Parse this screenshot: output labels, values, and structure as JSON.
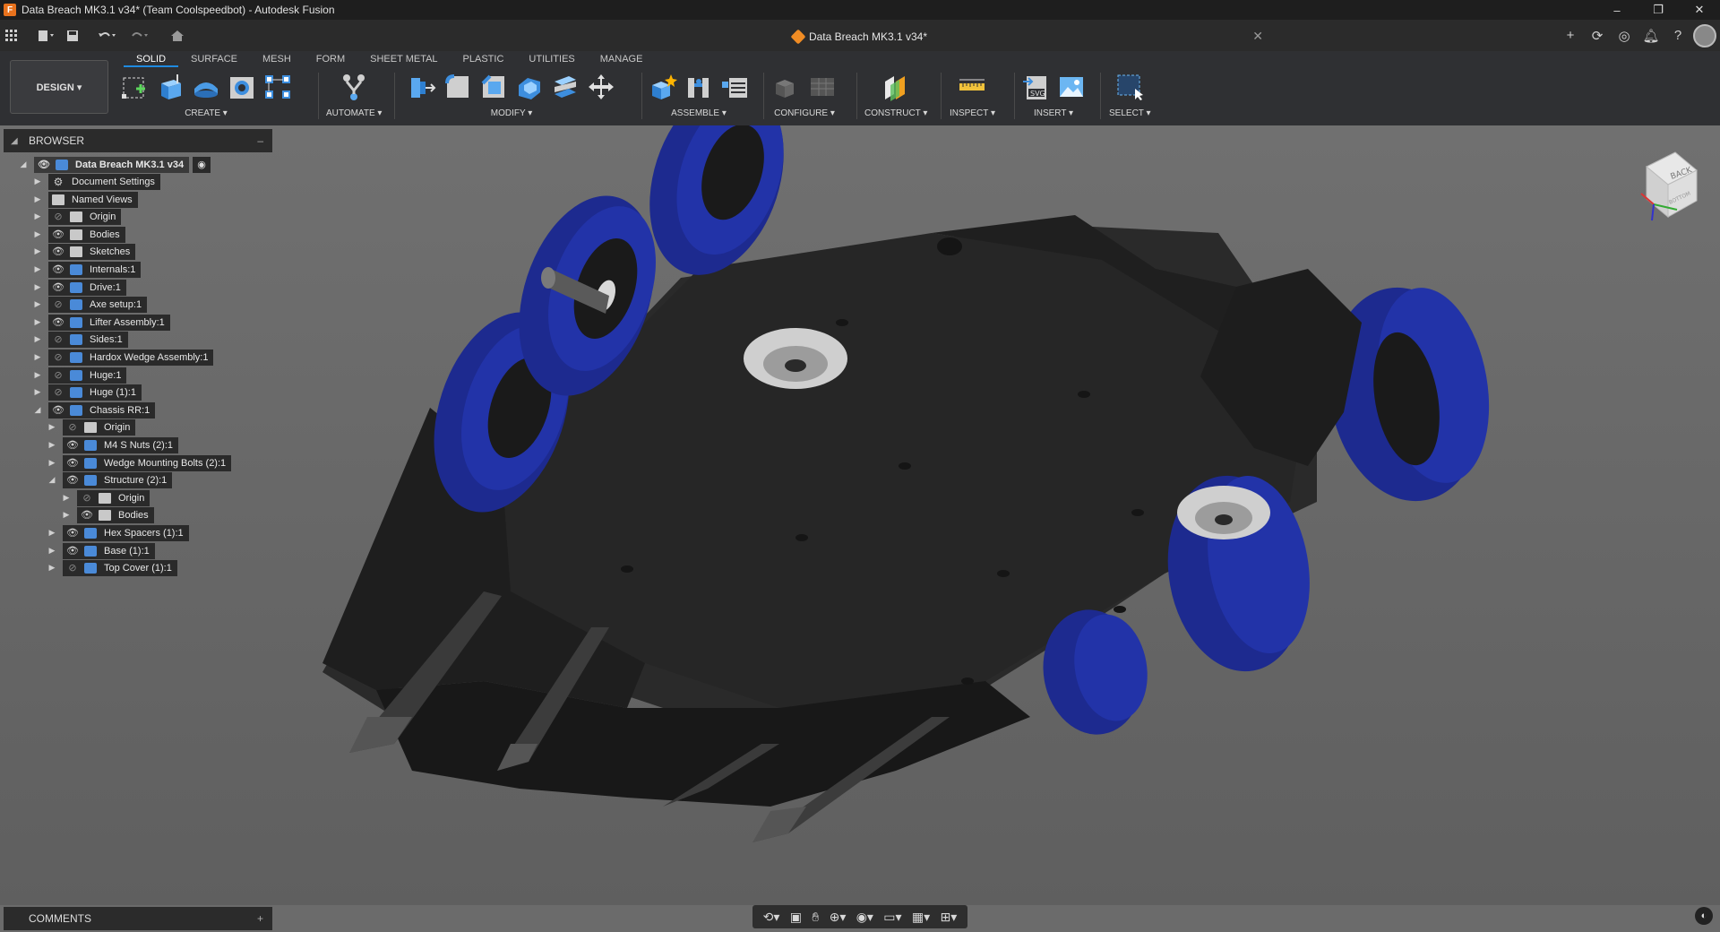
{
  "window": {
    "title": "Data Breach MK3.1 v34* (Team Coolspeedbot) - Autodesk Fusion",
    "controls": [
      "–",
      "❐",
      "✕"
    ]
  },
  "appbar": {
    "doc_tab_title": "Data Breach MK3.1 v34*",
    "tab_close": "✕",
    "left_buttons": [
      "grid-icon",
      "file-icon",
      "save-icon",
      "undo-icon",
      "redo-icon",
      "home-icon"
    ],
    "right_buttons": [
      "plus-icon",
      "sync-icon",
      "job-status-icon",
      "bell-icon",
      "help-icon",
      "avatar"
    ]
  },
  "workspace": {
    "label": "DESIGN ▾"
  },
  "ribbon_tabs": [
    "SOLID",
    "SURFACE",
    "MESH",
    "FORM",
    "SHEET METAL",
    "PLASTIC",
    "UTILITIES",
    "MANAGE"
  ],
  "ribbon_active": "SOLID",
  "tool_groups": {
    "create": "CREATE ▾",
    "automate": "AUTOMATE ▾",
    "modify": "MODIFY ▾",
    "assemble": "ASSEMBLE ▾",
    "configure": "CONFIGURE ▾",
    "construct": "CONSTRUCT ▾",
    "inspect": "INSPECT ▾",
    "insert": "INSERT ▾",
    "select": "SELECT ▾"
  },
  "browser": {
    "title": "BROWSER",
    "collapse": "◢",
    "pin": "–",
    "root": "Data Breach MK3.1 v34",
    "items": [
      {
        "label": "Document Settings",
        "icon": "gear",
        "eye": false
      },
      {
        "label": "Named Views",
        "icon": "folder",
        "eye": false
      },
      {
        "label": "Origin",
        "icon": "folder",
        "eye": "off"
      },
      {
        "label": "Bodies",
        "icon": "folder",
        "eye": "on"
      },
      {
        "label": "Sketches",
        "icon": "folder",
        "eye": "on"
      },
      {
        "label": "Internals:1",
        "icon": "comp",
        "eye": "on"
      },
      {
        "label": "Drive:1",
        "icon": "comp",
        "eye": "on"
      },
      {
        "label": "Axe setup:1",
        "icon": "comp",
        "eye": "off"
      },
      {
        "label": "Lifter Assembly:1",
        "icon": "comp",
        "eye": "on"
      },
      {
        "label": "Sides:1",
        "icon": "comp",
        "eye": "off"
      },
      {
        "label": "Hardox Wedge Assembly:1",
        "icon": "comp",
        "eye": "off"
      },
      {
        "label": "Huge:1",
        "icon": "comp",
        "eye": "off"
      },
      {
        "label": "Huge (1):1",
        "icon": "comp",
        "eye": "off"
      },
      {
        "label": "Chassis RR:1",
        "icon": "comp",
        "eye": "on"
      },
      {
        "label": "Origin",
        "icon": "folder",
        "eye": "off"
      },
      {
        "label": "M4 S Nuts (2):1",
        "icon": "comp",
        "eye": "on"
      },
      {
        "label": "Wedge Mounting Bolts (2):1",
        "icon": "comp",
        "eye": "on"
      },
      {
        "label": "Structure (2):1",
        "icon": "comp",
        "eye": "on"
      },
      {
        "label": "Origin",
        "icon": "folder",
        "eye": "off"
      },
      {
        "label": "Bodies",
        "icon": "folder",
        "eye": "on"
      },
      {
        "label": "Hex Spacers (1):1",
        "icon": "comp",
        "eye": "on"
      },
      {
        "label": "Base (1):1",
        "icon": "comp",
        "eye": "on"
      },
      {
        "label": "Top Cover (1):1",
        "icon": "comp",
        "eye": "off"
      }
    ]
  },
  "comments": {
    "title": "COMMENTS",
    "pin": "+"
  },
  "viewcube": {
    "face_label": "BACK",
    "bottom_label": "BOTTOM"
  },
  "colors": {
    "wheel": "#2233a8",
    "chassis": "#222222",
    "accent": "#1f8ae0"
  }
}
